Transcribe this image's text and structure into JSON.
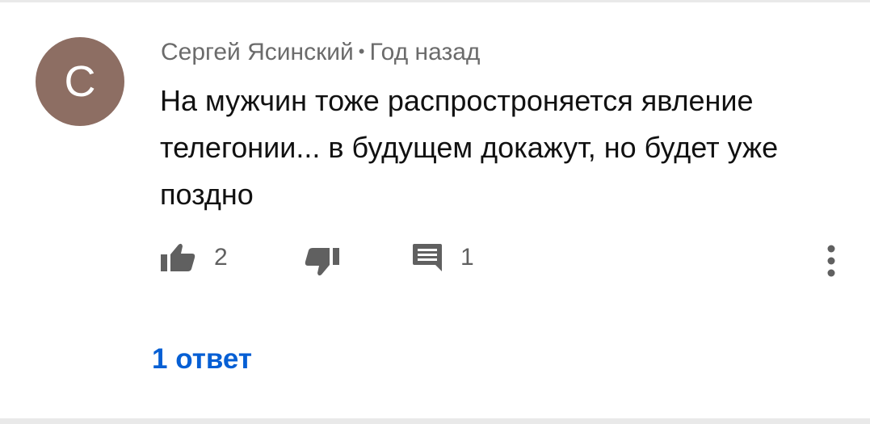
{
  "comment": {
    "avatar_letter": "С",
    "avatar_color": "#8d6e63",
    "author": "Сергей Ясинский",
    "separator": "•",
    "time": "Год назад",
    "text": "На мужчин тоже распростроняется явление телегонии... в будущем докажут, но будет уже поздно",
    "like_count": "2",
    "reply_count": "1",
    "replies_link": "1 ответ",
    "icons": {
      "like": "thumb-up-icon",
      "dislike": "thumb-down-icon",
      "reply": "comment-icon",
      "more": "more-vertical-icon"
    },
    "accent_color": "#065fd4"
  }
}
